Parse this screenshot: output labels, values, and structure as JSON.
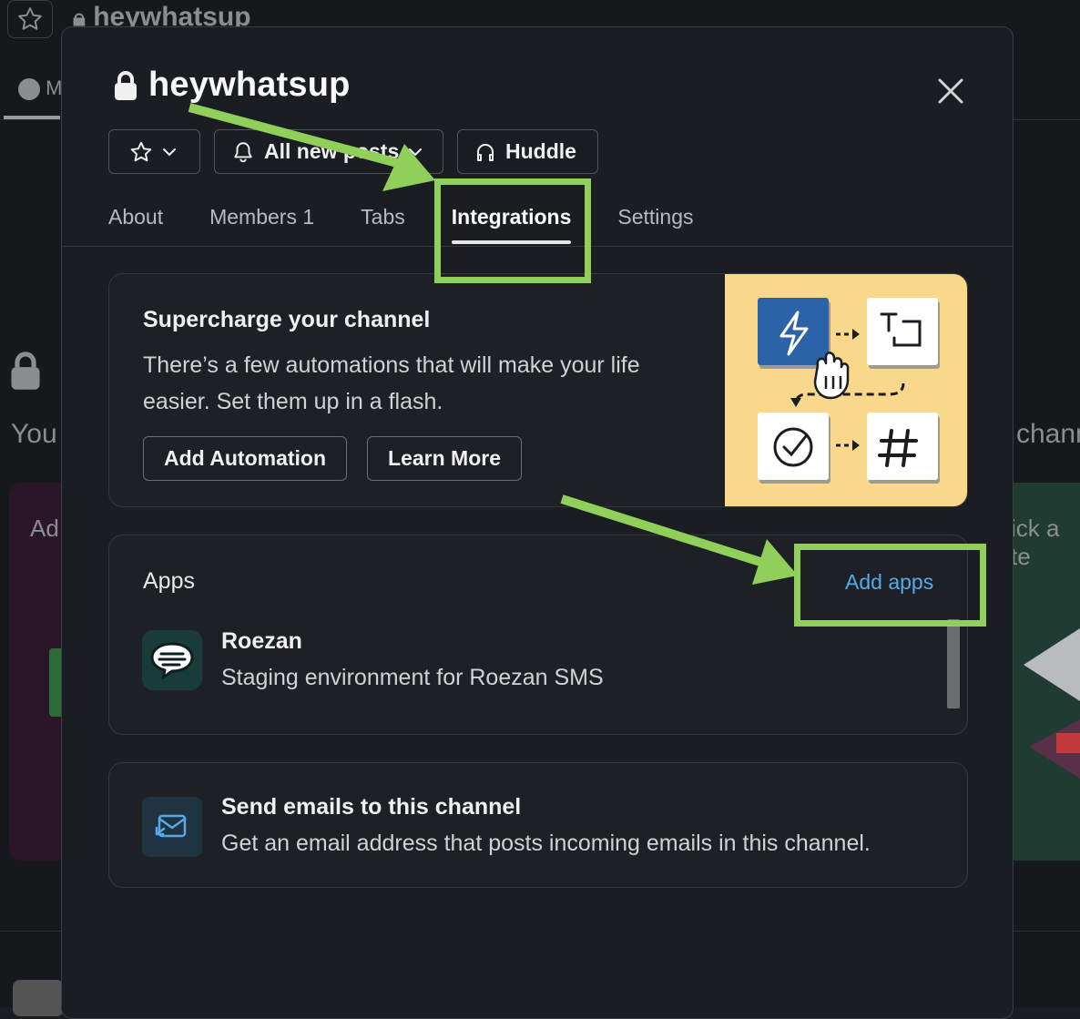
{
  "background": {
    "title": "heywhatsup",
    "tab_label": "M",
    "you_text": "You",
    "chann_text": "chann",
    "ad_text": "Ad",
    "pick_text": "ick a te"
  },
  "modal": {
    "title": "heywhatsup",
    "buttons": {
      "notify_label": "All new posts",
      "huddle_label": "Huddle"
    },
    "tabs": [
      {
        "label": "About"
      },
      {
        "label": "Members",
        "count": "1"
      },
      {
        "label": "Tabs"
      },
      {
        "label": "Integrations",
        "active": true
      },
      {
        "label": "Settings"
      }
    ],
    "supercharge": {
      "title": "Supercharge your channel",
      "description": "There’s a few automations that will make your life easier. Set them up in a flash.",
      "add_automation_label": "Add Automation",
      "learn_more_label": "Learn More"
    },
    "apps": {
      "title": "Apps",
      "add_apps_label": "Add apps",
      "items": [
        {
          "name": "Roezan",
          "description": "Staging environment for Roezan SMS"
        }
      ]
    },
    "email": {
      "title": "Send emails to this channel",
      "description": "Get an email address that posts incoming emails in this channel."
    }
  },
  "colors": {
    "highlight": "#8fcf5a",
    "link": "#58a9e8",
    "illustration_bg": "#f9d88c"
  }
}
